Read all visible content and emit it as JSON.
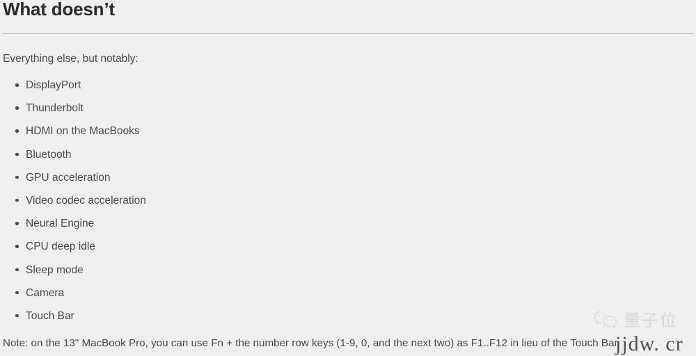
{
  "article": {
    "heading": "What doesn’t",
    "intro": "Everything else, but notably:",
    "items": [
      "DisplayPort",
      "Thunderbolt",
      "HDMI on the MacBooks",
      "Bluetooth",
      "GPU acceleration",
      "Video codec acceleration",
      "Neural Engine",
      "CPU deep idle",
      "Sleep mode",
      "Camera",
      "Touch Bar"
    ],
    "note": "Note: on the 13\" MacBook Pro, you can use Fn + the number row keys (1-9, 0, and the next two) as F1..F12 in lieu of the Touch Bar."
  },
  "watermark": {
    "icon": "wechat-icon",
    "label": "量子位",
    "url": "jjdw. cr"
  },
  "colors": {
    "background": "#efefef",
    "heading_text": "#2b2b2b",
    "body_text": "#4a4a4a",
    "divider": "#b9b9b9",
    "watermark_text": "#cfcfcf"
  }
}
